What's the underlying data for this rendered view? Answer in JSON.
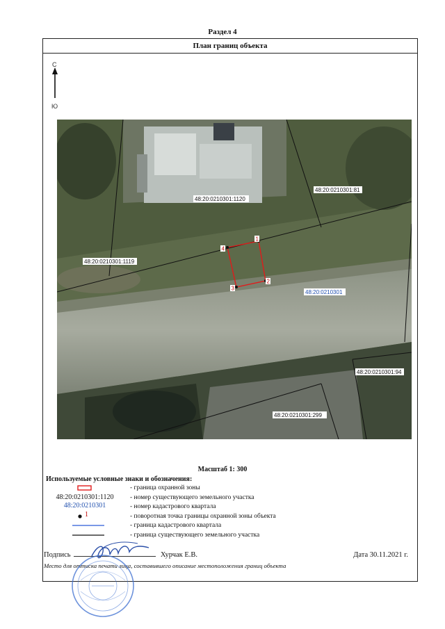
{
  "section": "Раздел 4",
  "plan_title": "План границ объекта",
  "north": {
    "top": "С",
    "bottom": "Ю"
  },
  "map": {
    "parcels": [
      "48:20:0210301:1120",
      "48:20:0210301:81",
      "48:20:0210301:1119",
      "48:20:0210301:94",
      "48:20:0210301:299"
    ],
    "quarter": "48:20:0210301",
    "points": [
      "1",
      "2",
      "3",
      "4"
    ]
  },
  "scale": "Масштаб 1: 300",
  "legend": {
    "title": "Используемые условные знаки и обозначения:",
    "items": [
      {
        "symbol": "",
        "text": "- граница  охранной зоны"
      },
      {
        "symbol": "48:20:0210301:1120",
        "text": "- номер существующего земельного участка"
      },
      {
        "symbol": "48:20:0210301",
        "text": "- номер кадастрового квартала"
      },
      {
        "symbol": "1",
        "text": "- поворотная точка границы охранной зоны объекта"
      },
      {
        "symbol": "",
        "text": "- граница кадастрового квартала"
      },
      {
        "symbol": "",
        "text": "- граница существующего земельного участка"
      }
    ]
  },
  "signature": {
    "label": "Подпись",
    "name": "Хурчак Е.В.",
    "date": "Дата 30.11.2021 г.",
    "note": "Место для оттиска печати лица, составившего описание местоположения границ объекта"
  },
  "colors": {
    "zone": "#e01b1b",
    "quarter_line": "#2a5bd7",
    "quarter_text": "#1f4fae",
    "stamp": "#3d6fd0"
  }
}
